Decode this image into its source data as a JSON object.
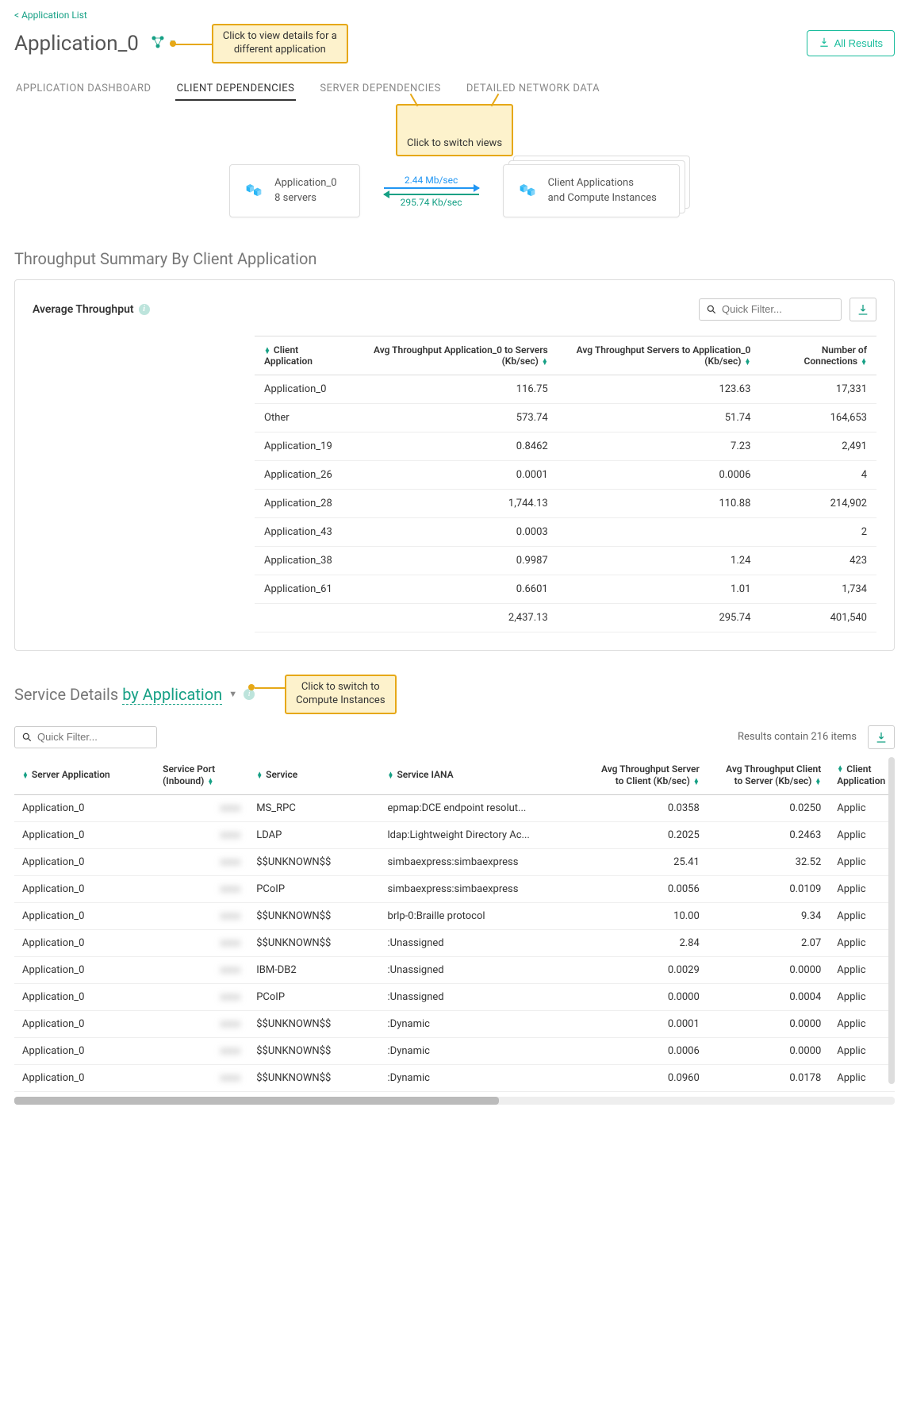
{
  "back_link": "< Application List",
  "page_title": "Application_0",
  "all_results_label": "All Results",
  "callout_switch_app": "Click to view details for a\ndifferent application",
  "callout_switch_views": "Click to switch views",
  "callout_switch_compute": "Click to switch to\nCompute Instances",
  "tabs": [
    {
      "label": "APPLICATION DASHBOARD",
      "active": false
    },
    {
      "label": "CLIENT DEPENDENCIES",
      "active": true
    },
    {
      "label": "SERVER DEPENDENCIES",
      "active": false
    },
    {
      "label": "DETAILED NETWORK DATA",
      "active": false
    }
  ],
  "diagram": {
    "left_title": "Application_0",
    "left_sub": "8 servers",
    "out_rate": "2.44 Mb/sec",
    "in_rate": "295.74 Kb/sec",
    "right_title": "Client Applications",
    "right_sub": "and Compute Instances"
  },
  "throughput_section_title": "Throughput Summary By Client Application",
  "avg_throughput_label": "Average Throughput",
  "quick_filter_placeholder": "Quick Filter...",
  "t1_headers": {
    "client": "Client Application",
    "to_servers": "Avg Throughput Application_0 to Servers (Kb/sec)",
    "to_app": "Avg Throughput Servers to Application_0 (Kb/sec)",
    "conns": "Number of Connections"
  },
  "t1_rows": [
    {
      "client": "Application_0",
      "to": "116.75",
      "from": "123.63",
      "conn": "17,331"
    },
    {
      "client": "Other",
      "to": "573.74",
      "from": "51.74",
      "conn": "164,653"
    },
    {
      "client": "Application_19",
      "to": "0.8462",
      "from": "7.23",
      "conn": "2,491"
    },
    {
      "client": "Application_26",
      "to": "0.0001",
      "from": "0.0006",
      "conn": "4"
    },
    {
      "client": "Application_28",
      "to": "1,744.13",
      "from": "110.88",
      "conn": "214,902"
    },
    {
      "client": "Application_43",
      "to": "0.0003",
      "from": "",
      "conn": "2"
    },
    {
      "client": "Application_38",
      "to": "0.9987",
      "from": "1.24",
      "conn": "423"
    },
    {
      "client": "Application_61",
      "to": "0.6601",
      "from": "1.01",
      "conn": "1,734"
    }
  ],
  "t1_totals": {
    "to": "2,437.13",
    "from": "295.74",
    "conn": "401,540"
  },
  "svc_title_prefix": "Service Details ",
  "svc_title_link": "by Application",
  "results_text": "Results contain 216 items",
  "t2_headers": {
    "server_app": "Server Application",
    "port": "Service Port (Inbound)",
    "service": "Service",
    "iana": "Service IANA",
    "s2c": "Avg Throughput Server to Client (Kb/sec)",
    "c2s": "Avg Throughput Client to Server (Kb/sec)",
    "client_app": "Client Application"
  },
  "t2_rows": [
    {
      "app": "Application_0",
      "port": "xxxx",
      "svc": "MS_RPC",
      "iana": "epmap:DCE endpoint resolut...",
      "s2c": "0.0358",
      "c2s": "0.0250",
      "cli": "Applic"
    },
    {
      "app": "Application_0",
      "port": "xxxx",
      "svc": "LDAP",
      "iana": "ldap:Lightweight Directory Ac...",
      "s2c": "0.2025",
      "c2s": "0.2463",
      "cli": "Applic"
    },
    {
      "app": "Application_0",
      "port": "xxxx",
      "svc": "$$UNKNOWN$$",
      "iana": "simbaexpress:simbaexpress",
      "s2c": "25.41",
      "c2s": "32.52",
      "cli": "Applic"
    },
    {
      "app": "Application_0",
      "port": "xxxx",
      "svc": "PCoIP",
      "iana": "simbaexpress:simbaexpress",
      "s2c": "0.0056",
      "c2s": "0.0109",
      "cli": "Applic"
    },
    {
      "app": "Application_0",
      "port": "xxxx",
      "svc": "$$UNKNOWN$$",
      "iana": "brlp-0:Braille protocol",
      "s2c": "10.00",
      "c2s": "9.34",
      "cli": "Applic"
    },
    {
      "app": "Application_0",
      "port": "xxxx",
      "svc": "$$UNKNOWN$$",
      "iana": ":Unassigned",
      "s2c": "2.84",
      "c2s": "2.07",
      "cli": "Applic"
    },
    {
      "app": "Application_0",
      "port": "xxxx",
      "svc": "IBM-DB2",
      "iana": ":Unassigned",
      "s2c": "0.0029",
      "c2s": "0.0000",
      "cli": "Applic"
    },
    {
      "app": "Application_0",
      "port": "xxxx",
      "svc": "PCoIP",
      "iana": ":Unassigned",
      "s2c": "0.0000",
      "c2s": "0.0004",
      "cli": "Applic"
    },
    {
      "app": "Application_0",
      "port": "xxxx",
      "svc": "$$UNKNOWN$$",
      "iana": ":Dynamic",
      "s2c": "0.0001",
      "c2s": "0.0000",
      "cli": "Applic"
    },
    {
      "app": "Application_0",
      "port": "xxxx",
      "svc": "$$UNKNOWN$$",
      "iana": ":Dynamic",
      "s2c": "0.0006",
      "c2s": "0.0000",
      "cli": "Applic"
    },
    {
      "app": "Application_0",
      "port": "xxxx",
      "svc": "$$UNKNOWN$$",
      "iana": ":Dynamic",
      "s2c": "0.0960",
      "c2s": "0.0178",
      "cli": "Applic"
    }
  ]
}
